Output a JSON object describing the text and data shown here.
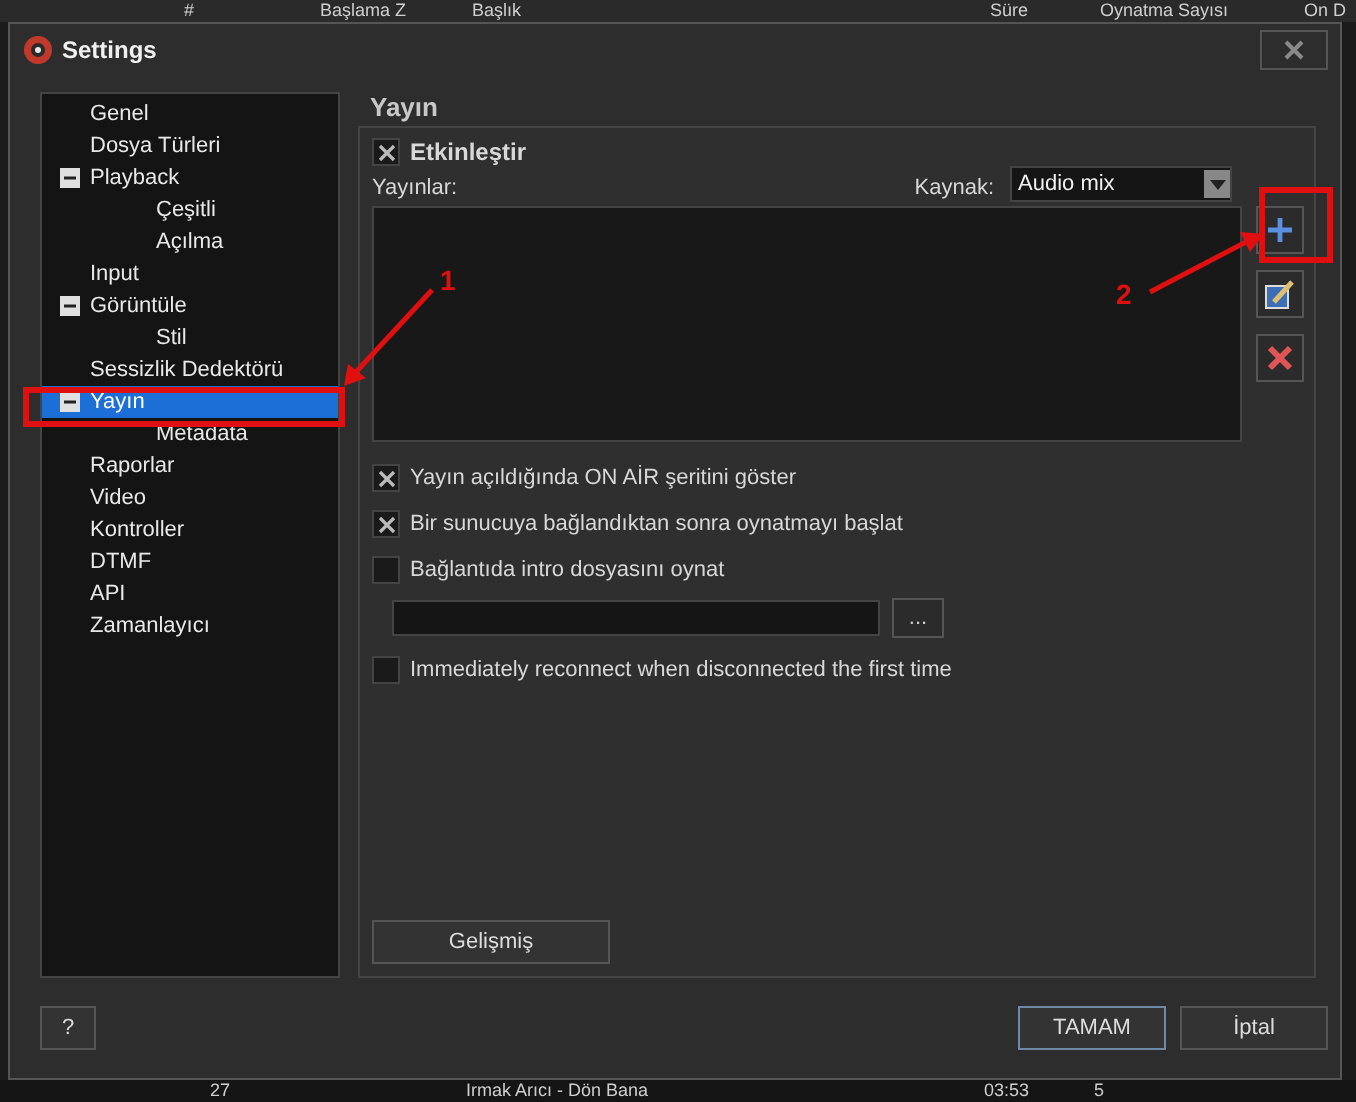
{
  "background_list": {
    "columns": [
      "#",
      "Başlama Z",
      "Başlık",
      "Süre",
      "Oynatma Sayısı",
      "On D"
    ],
    "row": [
      "27",
      "Irmak Arıcı - Dön Bana",
      "03:53",
      "5"
    ]
  },
  "window": {
    "title": "Settings"
  },
  "sidebar": {
    "items": [
      {
        "label": "Genel",
        "selected": false
      },
      {
        "label": "Dosya Türleri",
        "selected": false
      },
      {
        "label": "Playback",
        "selected": false,
        "expanded": true,
        "children": [
          {
            "label": "Çeşitli",
            "selected": false
          },
          {
            "label": "Açılma",
            "selected": false
          }
        ]
      },
      {
        "label": "Input",
        "selected": false
      },
      {
        "label": "Görüntüle",
        "selected": false,
        "expanded": true,
        "children": [
          {
            "label": "Stil",
            "selected": false
          }
        ]
      },
      {
        "label": "Sessizlik Dedektörü",
        "selected": false
      },
      {
        "label": "Yayın",
        "selected": true,
        "expanded": true,
        "children": [
          {
            "label": "Metadata",
            "selected": false
          }
        ]
      },
      {
        "label": "Raporlar",
        "selected": false
      },
      {
        "label": "Video",
        "selected": false
      },
      {
        "label": "Kontroller",
        "selected": false
      },
      {
        "label": "DTMF",
        "selected": false
      },
      {
        "label": "API",
        "selected": false
      },
      {
        "label": "Zamanlayıcı",
        "selected": false
      }
    ]
  },
  "page": {
    "title": "Yayın",
    "enable": {
      "label": "Etkinleştir",
      "checked": true
    },
    "source": {
      "label": "Kaynak:",
      "value": "Audio mix"
    },
    "list_label": "Yayınlar:",
    "options": [
      {
        "kind": "checkbox",
        "label": "Yayın açıldığında ON AİR şeritini göster",
        "checked": true
      },
      {
        "kind": "checkbox",
        "label": "Bir sunucuya bağlandıktan sonra oynatmayı başlat",
        "checked": true
      },
      {
        "kind": "checkbox",
        "label": "Bağlantıda intro dosyasını oynat",
        "checked": false
      },
      {
        "kind": "file",
        "button": "..."
      },
      {
        "kind": "checkbox",
        "label": "Immediately reconnect when disconnected the first time",
        "checked": false
      }
    ],
    "advanced_button": "Gelişmiş"
  },
  "buttons": {
    "help": "?",
    "ok": "TAMAM",
    "cancel": "İptal"
  },
  "annotations": [
    {
      "label": "1"
    },
    {
      "label": "2"
    }
  ]
}
